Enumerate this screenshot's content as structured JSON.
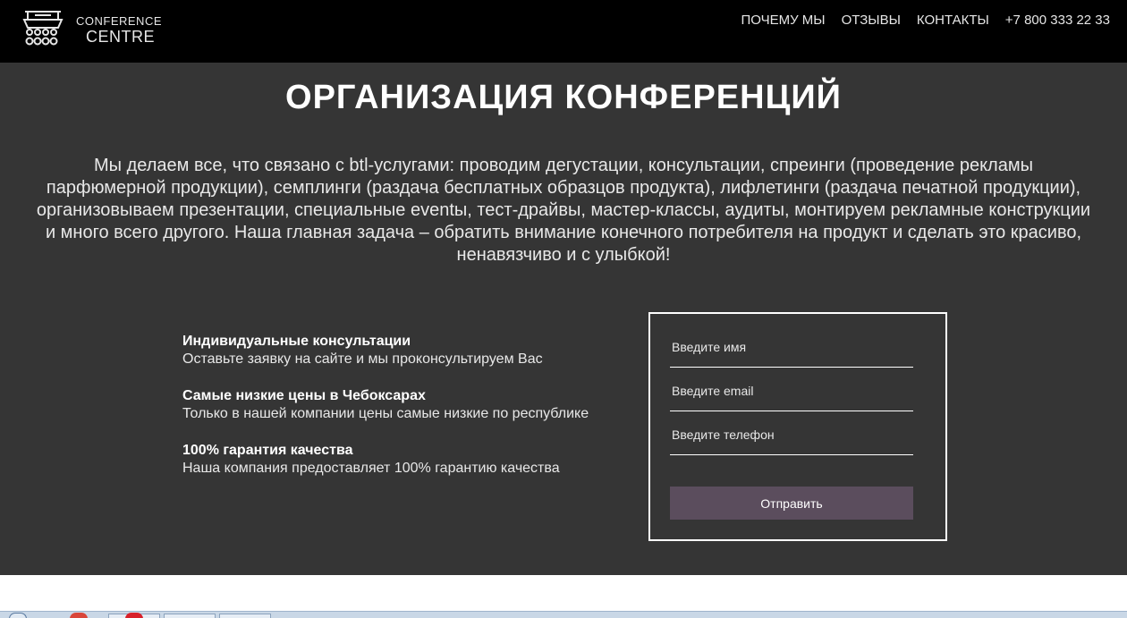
{
  "header": {
    "logo": {
      "line1": "CONFERENCE",
      "line2": "CENTRE",
      "icon": "conference-table-icon"
    },
    "nav": [
      {
        "label": "ПОЧЕМУ МЫ"
      },
      {
        "label": "ОТЗЫВЫ"
      },
      {
        "label": "КОНТАКТЫ"
      },
      {
        "label": "+7 800 333 22 33"
      }
    ]
  },
  "hero": {
    "title": "ОРГАНИЗАЦИЯ КОНФЕРЕНЦИЙ",
    "description": "Мы делаем все, что связано с btl-услугами: проводим дегустации, консультации, спреинги (проведение рекламы парфюмерной продукции), семплинги (раздача бесплатных образцов продукта), лифлетинги (раздача печатной продукции), организовываем презентации, специальные eventы, тест-драйвы, мастер-классы, аудиты, монтируем рекламные конструкции и много всего другого. Наша главная задача – обратить внимание конечного потребителя на продукт и сделать это красиво, ненавязчиво и с улыбкой!"
  },
  "features": [
    {
      "title": "Индивидуальные консультации",
      "text": "Оставьте заявку на сайте и мы проконсультируем Вас"
    },
    {
      "title": "Самые низкие цены в Чебоксарах",
      "text": "Только в нашей компании цены самые низкие по республике"
    },
    {
      "title": "100% гарантия качества",
      "text": "Наша компания предоставляет 100% гарантию качества"
    }
  ],
  "form": {
    "name_placeholder": "Введите имя",
    "name_value": "",
    "email_placeholder": "Введите email",
    "email_value": "",
    "phone_placeholder": "Введите телефон",
    "phone_value": "",
    "submit_label": "Отправить"
  },
  "colors": {
    "header_bg": "#000000",
    "hero_bg": "#353535",
    "button_bg": "#5b4d5d",
    "text": "#ffffff"
  }
}
